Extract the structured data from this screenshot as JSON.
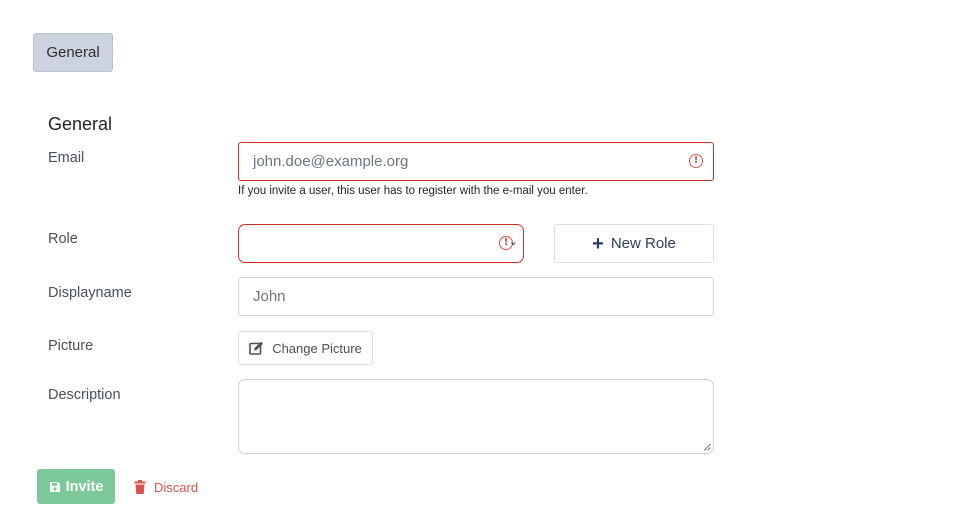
{
  "tabs": [
    {
      "label": "General"
    }
  ],
  "form": {
    "section_title": "General",
    "email": {
      "label": "Email",
      "placeholder": "john.doe@example.org",
      "help": "If you invite a user, this user has to register with the e-mail you enter.",
      "state": "invalid"
    },
    "role": {
      "label": "Role",
      "value": "",
      "state": "invalid",
      "new_role_label": "New Role"
    },
    "displayname": {
      "label": "Displayname",
      "value": "John"
    },
    "picture": {
      "label": "Picture",
      "button_label": "Change Picture"
    },
    "description": {
      "label": "Description",
      "value": ""
    }
  },
  "actions": {
    "invite_label": "Invite",
    "discard_label": "Discard"
  },
  "colors": {
    "error": "#d9534f",
    "success": "#7cc89a",
    "tab_active": "#ccd2de"
  },
  "icons": [
    "alert-circle-icon",
    "chevron-down-icon",
    "plus-icon",
    "edit-icon",
    "save-icon",
    "trash-icon"
  ]
}
